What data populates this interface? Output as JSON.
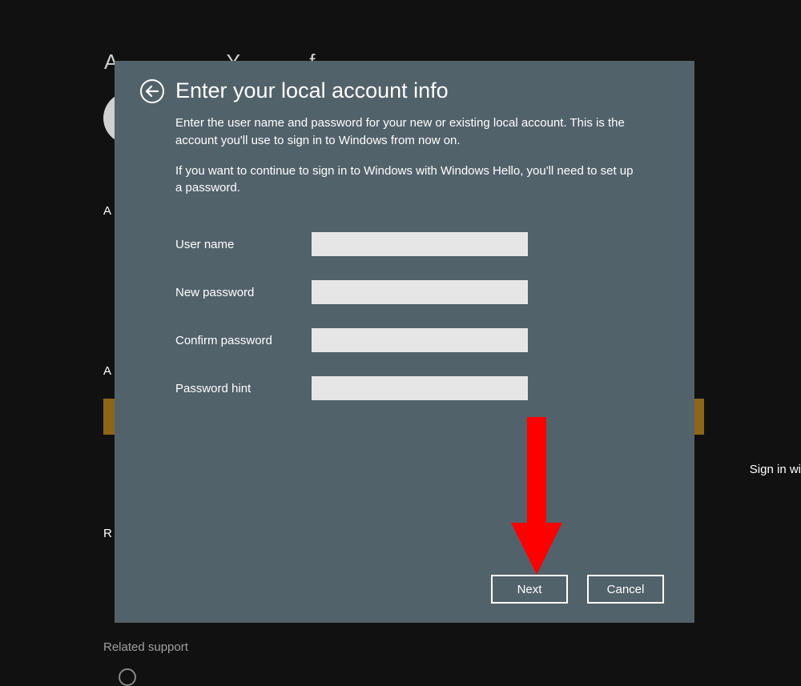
{
  "background": {
    "heading_fragment": "A                   Y            f",
    "section_a1": "A",
    "section_a2": "A",
    "section_r": "R",
    "sign_in_fragment": "Sign in wi",
    "related_support": "Related support"
  },
  "dialog": {
    "title": "Enter your local account info",
    "description1": "Enter the user name and password for your new or existing local account. This is the account you'll use to sign in to Windows from now on.",
    "description2": "If you want to continue to sign in to Windows with Windows Hello, you'll need to set up a password.",
    "fields": {
      "username_label": "User name",
      "username_value": "",
      "new_password_label": "New password",
      "new_password_value": "",
      "confirm_password_label": "Confirm password",
      "confirm_password_value": "",
      "password_hint_label": "Password hint",
      "password_hint_value": ""
    },
    "buttons": {
      "next": "Next",
      "cancel": "Cancel"
    }
  },
  "annotation": {
    "arrow_color": "#ff0000",
    "points_to": "next-button"
  }
}
